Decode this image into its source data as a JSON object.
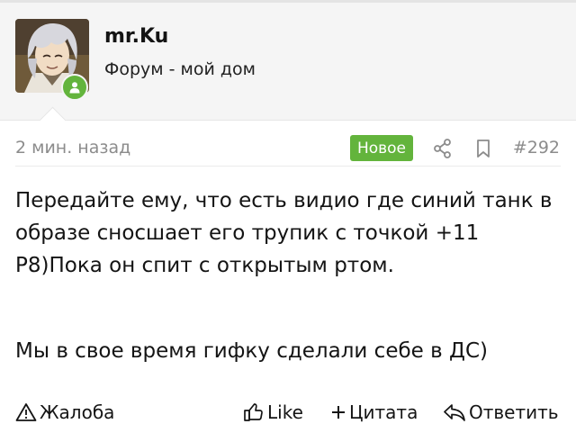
{
  "user": {
    "name": "mr.Ku",
    "title": "Форум - мой дом"
  },
  "post": {
    "time": "2 мин. назад",
    "badge": "Новое",
    "number": "#292",
    "message": [
      "Передайте ему, что есть видио где синий танк в образе сносшает его трупик с точкой +11 Р8)Пока он спит с открытым ртом.",
      "Мы в свое время гифку сделали себе в ДС)"
    ]
  },
  "actions": {
    "report": "Жалоба",
    "like": "Like",
    "quote": "Цитата",
    "reply": "Ответить"
  },
  "colors": {
    "accent_green": "#63b43c",
    "header_bg": "#f5f5f5",
    "muted_text": "#8c8c8c"
  },
  "icons": [
    "user-avatar",
    "online-status-icon",
    "share-icon",
    "bookmark-icon",
    "warning-icon",
    "thumbs-up-icon",
    "plus-icon",
    "reply-icon"
  ]
}
